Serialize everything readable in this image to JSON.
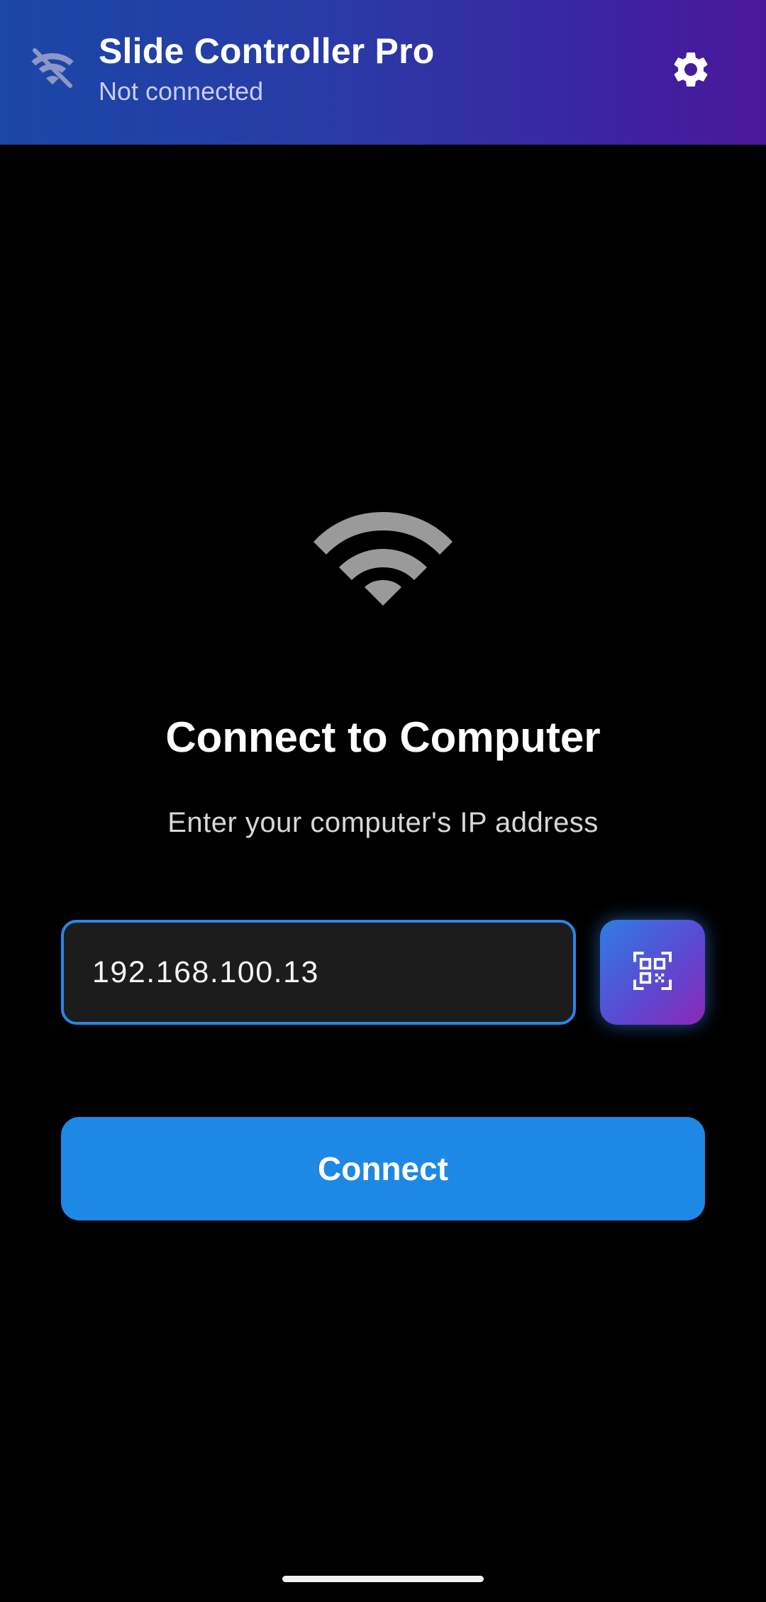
{
  "app_bar": {
    "title": "Slide Controller Pro",
    "subtitle": "Not connected",
    "status_icon": "wifi-off-icon",
    "settings_icon": "gear-icon",
    "gradient_start": "#1a47a8",
    "gradient_end": "#4b179a"
  },
  "main": {
    "illustration_icon": "wifi-icon",
    "heading": "Connect to Computer",
    "subheading": "Enter your computer's IP address",
    "ip_input": {
      "value": "192.168.100.13",
      "placeholder": ""
    },
    "qr_scan_icon": "qr-code-scan-icon",
    "connect_label": "Connect"
  },
  "colors": {
    "background": "#000000",
    "accent": "#1e88e5",
    "input_border": "#2a86e6",
    "input_bg": "#1c1c1c",
    "muted_icon": "#9a9a9a"
  }
}
